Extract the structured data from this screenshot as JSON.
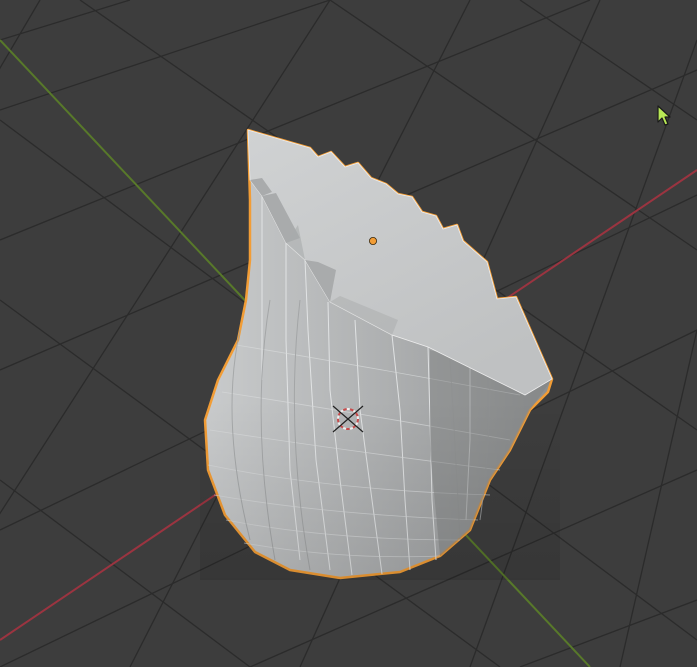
{
  "viewport": {
    "background": "#3d3d3d",
    "grid_color": "#2c2c2c",
    "x_axis_color": "#9b3440",
    "y_axis_color": "#58792a"
  },
  "object": {
    "selected": true,
    "outline_color": "#f29d36",
    "fill_color": "#b9bbbc",
    "top_face_color": "#c7c9ca",
    "origin_color": "#f29d36"
  },
  "cursor_3d": {
    "icon": "3d-cursor-icon",
    "ring_colors": [
      "#c84b4b",
      "#f0f0f0"
    ]
  },
  "mouse_pointer": {
    "icon": "arrow-cursor-icon",
    "color": "#b8e855"
  }
}
